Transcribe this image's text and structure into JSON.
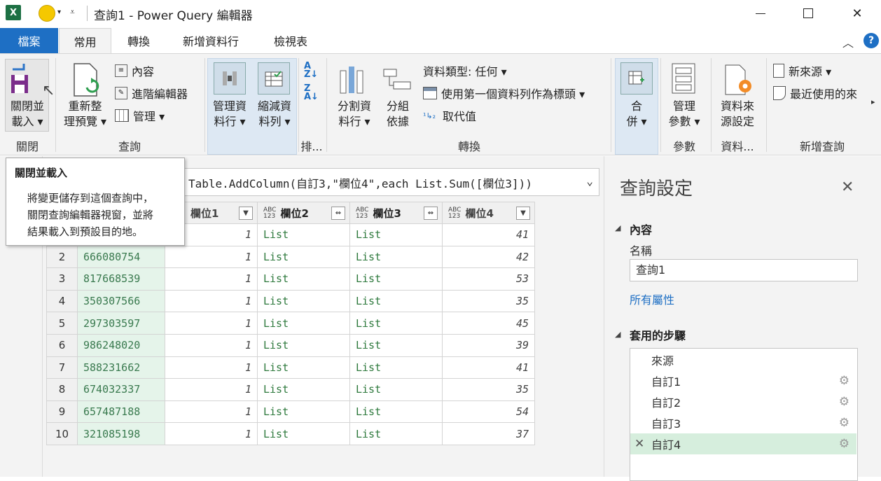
{
  "window": {
    "title": "查詢1 - Power Query 編輯器",
    "app_icon": "excel-icon",
    "minimize_icon": "minimize-icon",
    "maximize_icon": "maximize-icon",
    "close_icon": "close-icon"
  },
  "menu": {
    "tabs": [
      {
        "label": "檔案"
      },
      {
        "label": "常用"
      },
      {
        "label": "轉換"
      },
      {
        "label": "新增資料行"
      },
      {
        "label": "檢視表"
      }
    ],
    "active_tab": "常用"
  },
  "ribbon": {
    "groups": {
      "close": "關閉",
      "query": "查詢",
      "sort": "排...",
      "transform": "轉換",
      "combine_blank": "",
      "params": "參數",
      "datasource": "資料...",
      "newquery": "新增查詢"
    },
    "close_load_l1": "關閉並",
    "close_load_l2": "載入 ▾",
    "refresh_l1": "重新整",
    "refresh_l2": "理預覽 ▾",
    "properties": "內容",
    "advanced_editor": "進階編輯器",
    "manage": "管理 ▾",
    "manage_cols_l1": "管理資",
    "manage_cols_l2": "料行 ▾",
    "reduce_rows_l1": "縮減資",
    "reduce_rows_l2": "料列 ▾",
    "split_col_l1": "分割資",
    "split_col_l2": "料行 ▾",
    "group_by_l1": "分組",
    "group_by_l2": "依據",
    "data_type": "資料類型: 任何 ▾",
    "first_row_header": "使用第一個資料列作為標頭 ▾",
    "replace_values": "取代值",
    "combine_l1": "合",
    "combine_l2": "併 ▾",
    "manage_params_l1": "管理",
    "manage_params_l2": "參數 ▾",
    "ds_settings_l1": "資料來",
    "ds_settings_l2": "源設定",
    "new_source": "新來源 ▾",
    "recent_sources": "最近使用的來"
  },
  "tooltip": {
    "title": "關閉並載入",
    "body_l1": "將變更儲存到這個查詢中，",
    "body_l2": "關閉查詢編輯器視窗，並將",
    "body_l3": "結果載入到預設目的地。"
  },
  "formula": "Table.AddColumn(自訂3,\"欄位4\",each List.Sum([欄位3]))",
  "grid": {
    "headers": [
      {
        "label": "欄位1",
        "type": ""
      },
      {
        "label": "欄位2",
        "type": "ABC\n123"
      },
      {
        "label": "欄位3",
        "type": "ABC\n123"
      },
      {
        "label": "欄位4",
        "type": "ABC\n123"
      }
    ],
    "rows": [
      {
        "n": "1",
        "id": "",
        "c1": "1",
        "c2": "List",
        "c3": "List",
        "c4": "41"
      },
      {
        "n": "2",
        "id": "666080754",
        "c1": "1",
        "c2": "List",
        "c3": "List",
        "c4": "42"
      },
      {
        "n": "3",
        "id": "817668539",
        "c1": "1",
        "c2": "List",
        "c3": "List",
        "c4": "53"
      },
      {
        "n": "4",
        "id": "350307566",
        "c1": "1",
        "c2": "List",
        "c3": "List",
        "c4": "35"
      },
      {
        "n": "5",
        "id": "297303597",
        "c1": "1",
        "c2": "List",
        "c3": "List",
        "c4": "45"
      },
      {
        "n": "6",
        "id": "986248020",
        "c1": "1",
        "c2": "List",
        "c3": "List",
        "c4": "39"
      },
      {
        "n": "7",
        "id": "588231662",
        "c1": "1",
        "c2": "List",
        "c3": "List",
        "c4": "41"
      },
      {
        "n": "8",
        "id": "674032337",
        "c1": "1",
        "c2": "List",
        "c3": "List",
        "c4": "35"
      },
      {
        "n": "9",
        "id": "657487188",
        "c1": "1",
        "c2": "List",
        "c3": "List",
        "c4": "54"
      },
      {
        "n": "10",
        "id": "321085198",
        "c1": "1",
        "c2": "List",
        "c3": "List",
        "c4": "37"
      }
    ]
  },
  "settings": {
    "title": "查詢設定",
    "properties_header": "內容",
    "name_label": "名稱",
    "name_value": "查詢1",
    "all_properties": "所有屬性",
    "steps_header": "套用的步驟",
    "steps": [
      {
        "label": "來源"
      },
      {
        "label": "自訂1"
      },
      {
        "label": "自訂2"
      },
      {
        "label": "自訂3"
      },
      {
        "label": "自訂4"
      }
    ]
  },
  "colors": {
    "file_tab": "#1e6fc4",
    "accent": "#1e6fc4",
    "selected_step": "#d6eedd",
    "key_column_bg": "#e5f4ea"
  }
}
